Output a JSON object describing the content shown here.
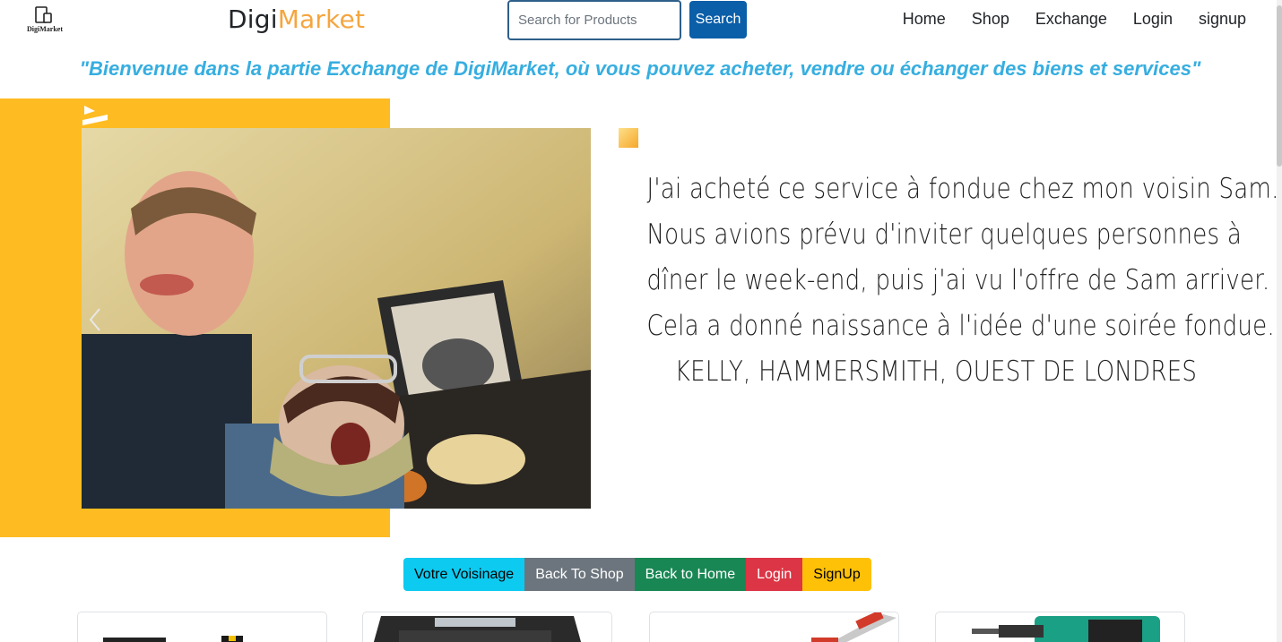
{
  "header": {
    "logo_caption": "DigiMarket",
    "brand_part1": "Digi",
    "brand_part2": "Market",
    "search_placeholder": "Search for Products",
    "search_button": "Search",
    "nav": [
      "Home",
      "Shop",
      "Exchange",
      "Login",
      "signup"
    ]
  },
  "welcome_text": "\"Bienvenue dans la partie Exchange de DigiMarket, où vous pouvez acheter, vendre ou échanger des biens et services\"",
  "hero": {
    "quote_lines": [
      "J'ai acheté ce service à fondue chez mon voisin Sam.",
      "Nous avions prévu d'inviter quelques personnes à",
      "dîner le week-end, puis j'ai vu l'offre de Sam arriver.",
      "Cela a donné naissance à l'idée d'une soirée fondue.",
      "KELLY, HAMMERSMITH, OUEST DE LONDRES"
    ],
    "accent_color": "#febc22"
  },
  "buttons": {
    "voisinage": "Votre Voisinage",
    "back_shop": "Back To Shop",
    "back_home": "Back to Home",
    "login": "Login",
    "signup": "SignUp"
  },
  "colors": {
    "brand_orange": "#f4a640",
    "welcome_blue": "#36aee0",
    "search_blue": "#0b5ea8"
  }
}
